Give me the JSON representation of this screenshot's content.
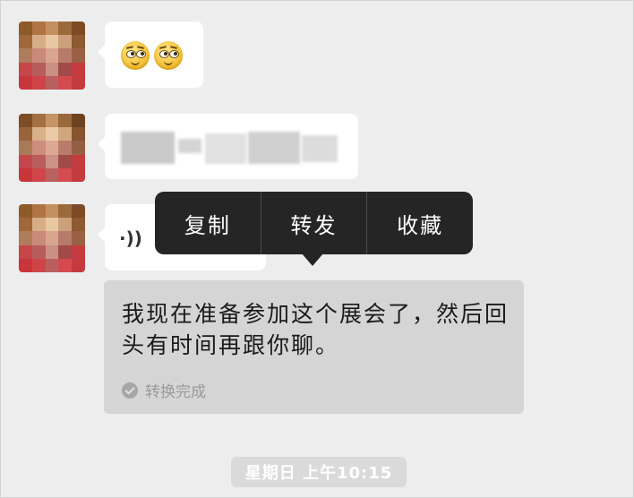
{
  "messages": [
    {
      "type": "emoji",
      "emoji_icons": [
        "face-with-rolling-eyes-icon",
        "face-with-rolling-eyes-icon"
      ]
    },
    {
      "type": "text-blurred"
    },
    {
      "type": "voice",
      "voice_icon": "voice-wave-icon",
      "voice_glyph": "·))"
    }
  ],
  "context_menu": {
    "items": [
      "复制",
      "转发",
      "收藏"
    ]
  },
  "transcription": {
    "text": "我现在准备参加这个展会了，然后回头有时间再跟你聊。",
    "status": "转换完成",
    "status_icon": "check-circle-icon"
  },
  "timestamp": "星期日 上午10:15",
  "colors": {
    "background": "#ededed",
    "bubble": "#ffffff",
    "menu": "#252525",
    "transcript_bg": "#d5d5d5"
  }
}
